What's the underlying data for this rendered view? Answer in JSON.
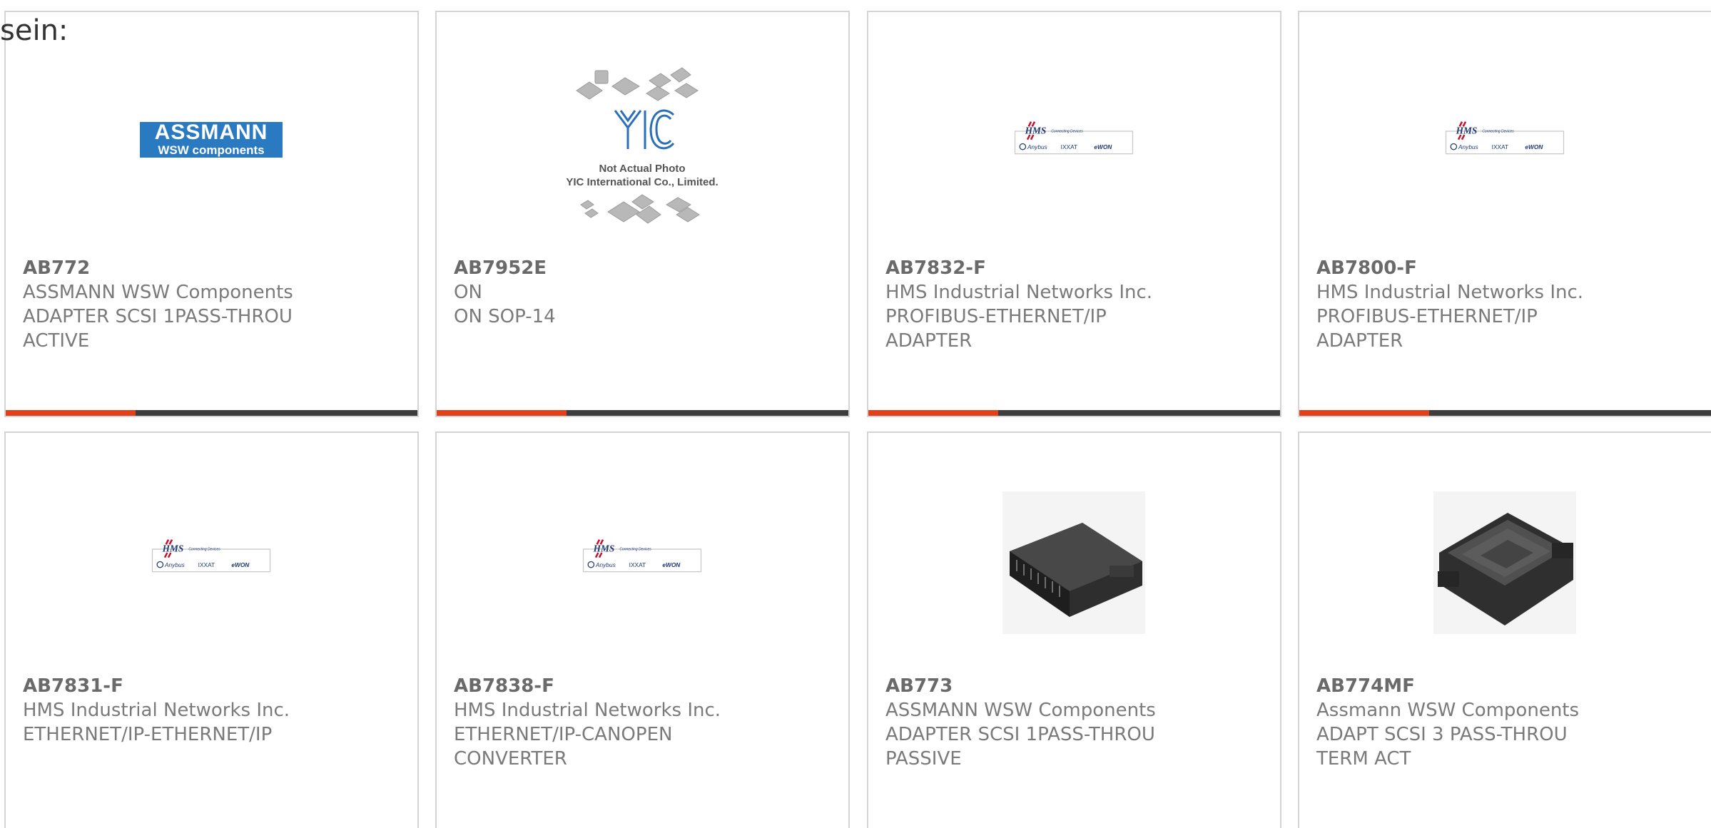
{
  "intro": {
    "text": "sein:"
  },
  "products": [
    {
      "part_number": "AB772",
      "manufacturer": "ASSMANN WSW Components",
      "description_lines": [
        "ADAPTER SCSI 1PASS-THROU",
        "ACTIVE"
      ],
      "image": {
        "type": "assmann-logo",
        "logo_top": "ASSMANN",
        "logo_bottom": "WSW components"
      }
    },
    {
      "part_number": "AB7952E",
      "manufacturer": "ON",
      "description_lines": [
        "ON SOP-14"
      ],
      "image": {
        "type": "yic-placeholder",
        "logo_text": "YIC",
        "caption_lines": [
          "Not Actual Photo",
          "YIC International Co., Limited."
        ]
      }
    },
    {
      "part_number": "AB7832-F",
      "manufacturer": "HMS Industrial Networks Inc.",
      "description_lines": [
        "PROFIBUS-ETHERNET/IP",
        "ADAPTER"
      ],
      "image": {
        "type": "hms-logo",
        "logo_text": "HMS",
        "tagline": "Connecting Devices",
        "brands": [
          "Anybus",
          "IXXAT",
          "eWON"
        ]
      }
    },
    {
      "part_number": "AB7800-F",
      "manufacturer": "HMS Industrial Networks Inc.",
      "description_lines": [
        "PROFIBUS-ETHERNET/IP",
        "ADAPTER"
      ],
      "image": {
        "type": "hms-logo",
        "logo_text": "HMS",
        "tagline": "Connecting Devices",
        "brands": [
          "Anybus",
          "IXXAT",
          "eWON"
        ]
      }
    },
    {
      "part_number": "AB7831-F",
      "manufacturer": "HMS Industrial Networks Inc.",
      "description_lines": [
        "ETHERNET/IP-ETHERNET/IP"
      ],
      "image": {
        "type": "hms-logo",
        "logo_text": "HMS",
        "tagline": "Connecting Devices",
        "brands": [
          "Anybus",
          "IXXAT",
          "eWON"
        ]
      }
    },
    {
      "part_number": "AB7838-F",
      "manufacturer": "HMS Industrial Networks Inc.",
      "description_lines": [
        "ETHERNET/IP-CANOPEN",
        "CONVERTER"
      ],
      "image": {
        "type": "hms-logo",
        "logo_text": "HMS",
        "tagline": "Connecting Devices",
        "brands": [
          "Anybus",
          "IXXAT",
          "eWON"
        ]
      }
    },
    {
      "part_number": "AB773",
      "manufacturer": "ASSMANN WSW Components",
      "description_lines": [
        "ADAPTER SCSI 1PASS-THROU",
        "PASSIVE"
      ],
      "image": {
        "type": "adapter-photo-angled"
      }
    },
    {
      "part_number": "AB774MF",
      "manufacturer": "Assmann WSW Components",
      "description_lines": [
        "ADAPT SCSI 3 PASS-THROU",
        "TERM ACT"
      ],
      "image": {
        "type": "adapter-photo-flat"
      }
    }
  ],
  "colors": {
    "accent": "#e2401b",
    "bar": "#3d3d3d",
    "card_border": "#d4d4d4",
    "text": "#7a7a7a",
    "assmann_blue": "#2a7ac2",
    "hms_red": "#c8102e",
    "hms_navy": "#1f3a70"
  }
}
